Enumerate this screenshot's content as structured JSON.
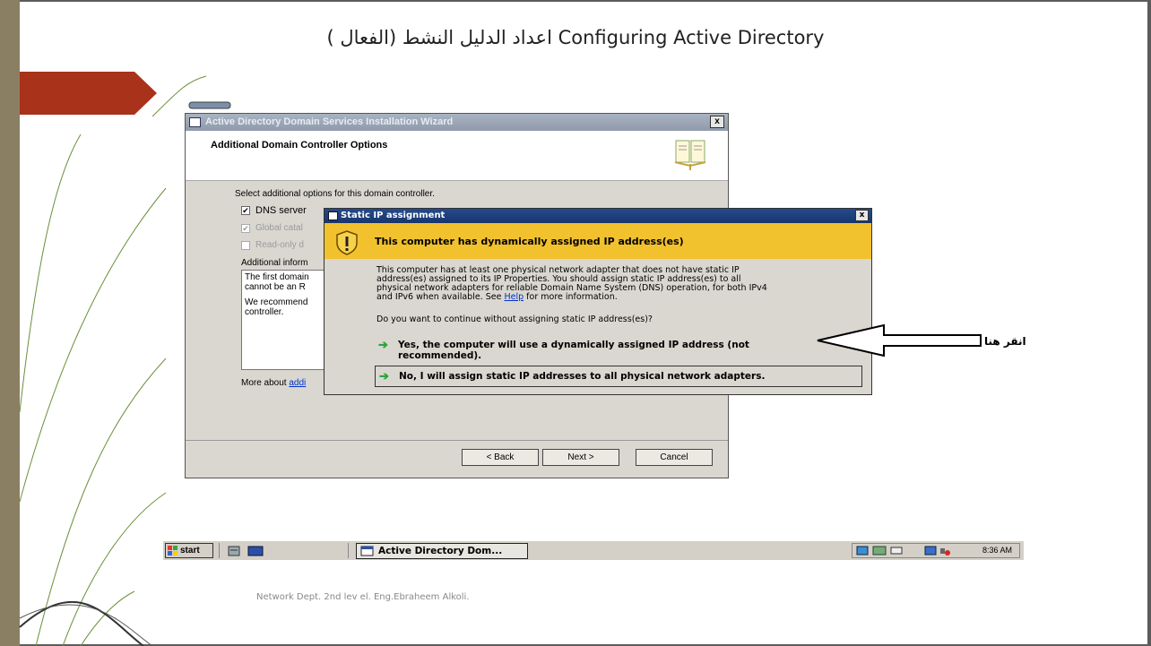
{
  "slide": {
    "title": "اعداد الدليل النشط (الفعال )  Configuring Active Directory",
    "footer": "Network Dept. 2nd lev el. Eng.Ebraheem Alkoli.",
    "annotation_label": "انقر هنا",
    "colors": {
      "accent_arrow": "#a8321a",
      "left_bar": "#8a7f63"
    }
  },
  "wizard": {
    "title": "Active Directory Domain Services Installation Wizard",
    "close": "x",
    "heading": "Additional Domain Controller Options",
    "prompt": "Select additional options for this domain controller.",
    "options": [
      {
        "label": "DNS server",
        "checked": true
      },
      {
        "label": "Global catal",
        "checked": true,
        "disabled": true
      },
      {
        "label": "Read-only d",
        "checked": false,
        "disabled": true
      }
    ],
    "info_label": "Additional inform",
    "info_text_1": "The first domain",
    "info_text_2": "cannot be an R",
    "info_text_3": "We recommend",
    "info_text_4": "controller.",
    "more_about": "More about",
    "more_link": "addi",
    "buttons": {
      "back": "< Back",
      "next": "Next >",
      "cancel": "Cancel"
    }
  },
  "dialog": {
    "title": "Static IP assignment",
    "close": "x",
    "heading": "This computer has dynamically assigned IP address(es)",
    "body_line1": "This computer has at least one physical network adapter that does not have static IP",
    "body_line2": "address(es) assigned to its IP Properties. You should assign static IP address(es) to all",
    "body_line3": "physical network adapters for reliable Domain Name System (DNS) operation, for both IPv4",
    "body_line4a": "and IPv6 when available. See",
    "body_help": "Help",
    "body_line4b": "for more information.",
    "question": "Do you want to continue without assigning static IP address(es)?",
    "option_yes_line1": "Yes, the computer will use a dynamically assigned IP address (not",
    "option_yes_line2": "recommended).",
    "option_no": "No, I will assign static IP addresses to all physical network adapters.",
    "arrow_glyph": "➔"
  },
  "taskbar": {
    "start": "start",
    "task": "Active Directory Dom...",
    "clock": "8:36 AM"
  }
}
